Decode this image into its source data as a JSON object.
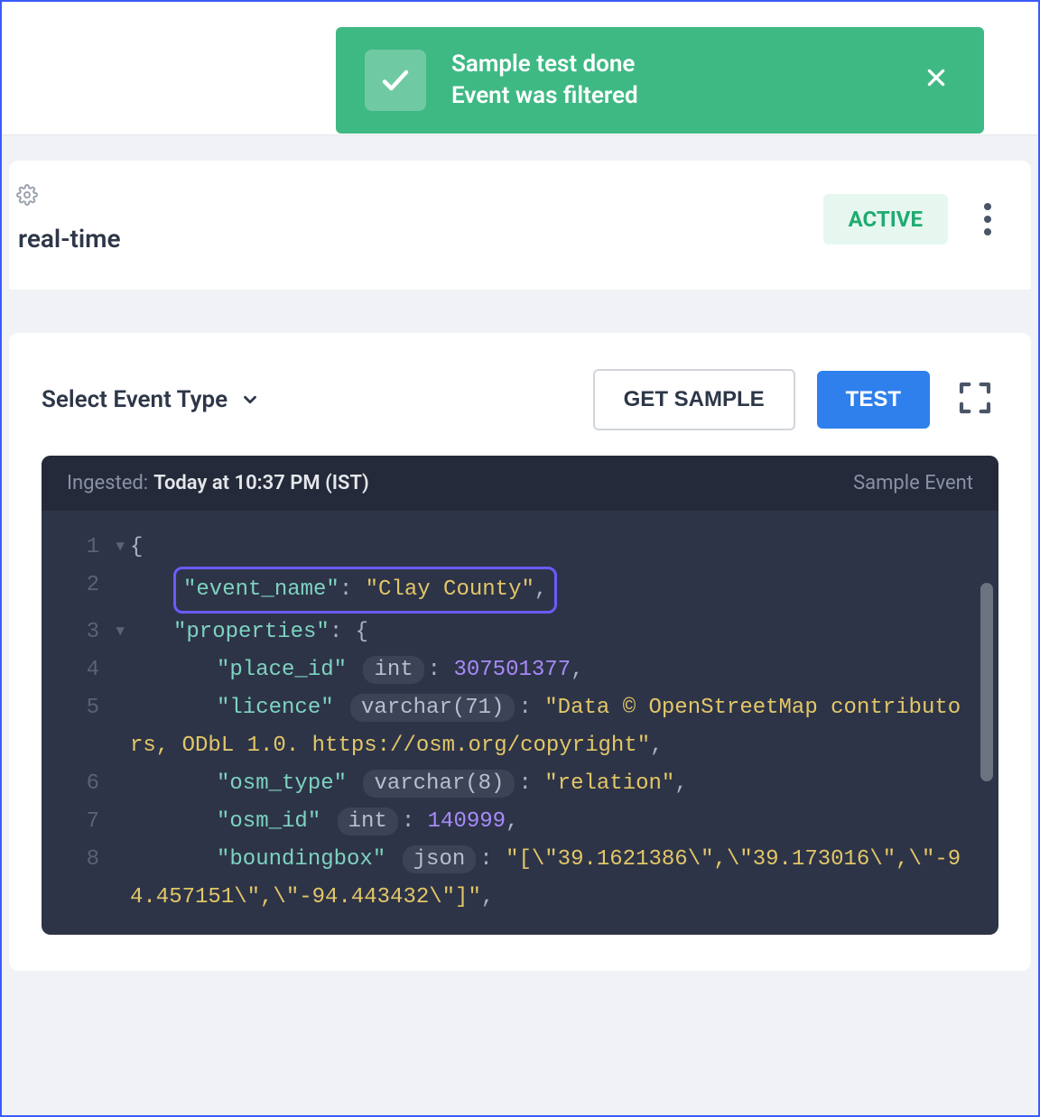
{
  "toast": {
    "title": "Sample test done",
    "subtitle": "Event was filtered"
  },
  "header": {
    "title": "real-time",
    "status": "ACTIVE"
  },
  "toolbar": {
    "select_label": "Select Event Type",
    "get_sample_label": "GET SAMPLE",
    "test_label": "TEST"
  },
  "code_header": {
    "ingested_label": "Ingested:",
    "ingested_time": "Today at 10:37 PM (IST)",
    "sample_label": "Sample Event"
  },
  "code": {
    "line1_brace": "{",
    "line2_key": "\"event_name\"",
    "line2_val": "\"Clay County\"",
    "line3_key": "\"properties\"",
    "line3_brace": "{",
    "line4_key": "\"place_id\"",
    "line4_type": "int",
    "line4_val": "307501377",
    "line5_key": "\"licence\"",
    "line5_type": "varchar(71)",
    "line5_val": "\"Data © OpenStreetMap contributors, ODbL 1.0. https://osm.org/copyright\"",
    "line6_key": "\"osm_type\"",
    "line6_type": "varchar(8)",
    "line6_val": "\"relation\"",
    "line7_key": "\"osm_id\"",
    "line7_type": "int",
    "line7_val": "140999",
    "line8_key": "\"boundingbox\"",
    "line8_type": "json",
    "line8_val": "\"[\\\"39.1621386\\\",\\\"39.173016\\\",\\\"-94.457151\\\",\\\"-94.443432\\\"]\""
  }
}
